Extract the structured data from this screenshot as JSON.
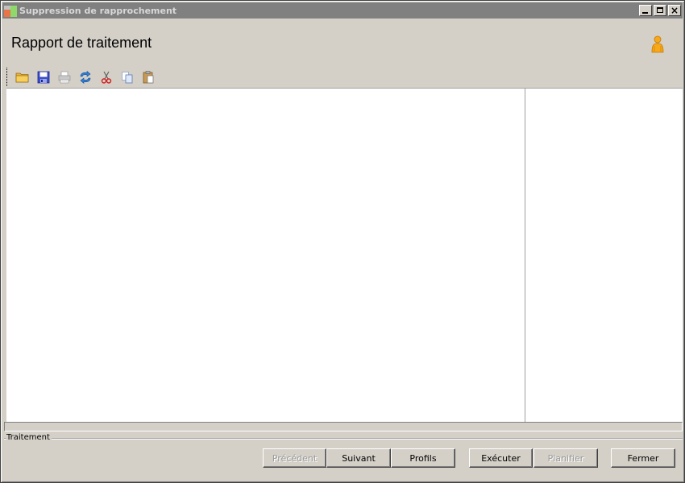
{
  "window": {
    "title": "Suppression de rapprochement",
    "controls": [
      "minimize",
      "maximize",
      "close"
    ],
    "close_glyph": "×"
  },
  "header": {
    "title": "Rapport de traitement",
    "icon": "user-icon"
  },
  "toolbar": {
    "items": [
      {
        "name": "open-folder-icon",
        "enabled": true
      },
      {
        "name": "save-icon",
        "enabled": true
      },
      {
        "name": "print-icon",
        "enabled": false
      },
      {
        "name": "refresh-icon",
        "enabled": true
      },
      {
        "name": "cut-icon",
        "enabled": true
      },
      {
        "name": "copy-icon",
        "enabled": true
      },
      {
        "name": "paste-icon",
        "enabled": true
      }
    ]
  },
  "footer": {
    "group_label": "Traitement",
    "buttons": {
      "previous": {
        "label": "Précédent",
        "enabled": false
      },
      "next": {
        "label": "Suivant",
        "enabled": true
      },
      "profiles": {
        "label": "Profils",
        "enabled": true
      },
      "execute": {
        "label": "Exécuter",
        "enabled": true
      },
      "schedule": {
        "label": "Planifier",
        "enabled": false
      },
      "close": {
        "label": "Fermer",
        "enabled": true
      }
    }
  },
  "colors": {
    "face": "#d4d0c8",
    "titlebar_inactive": "#808080",
    "content_bg": "#ffffff",
    "disabled_text": "#9a9a9a"
  }
}
